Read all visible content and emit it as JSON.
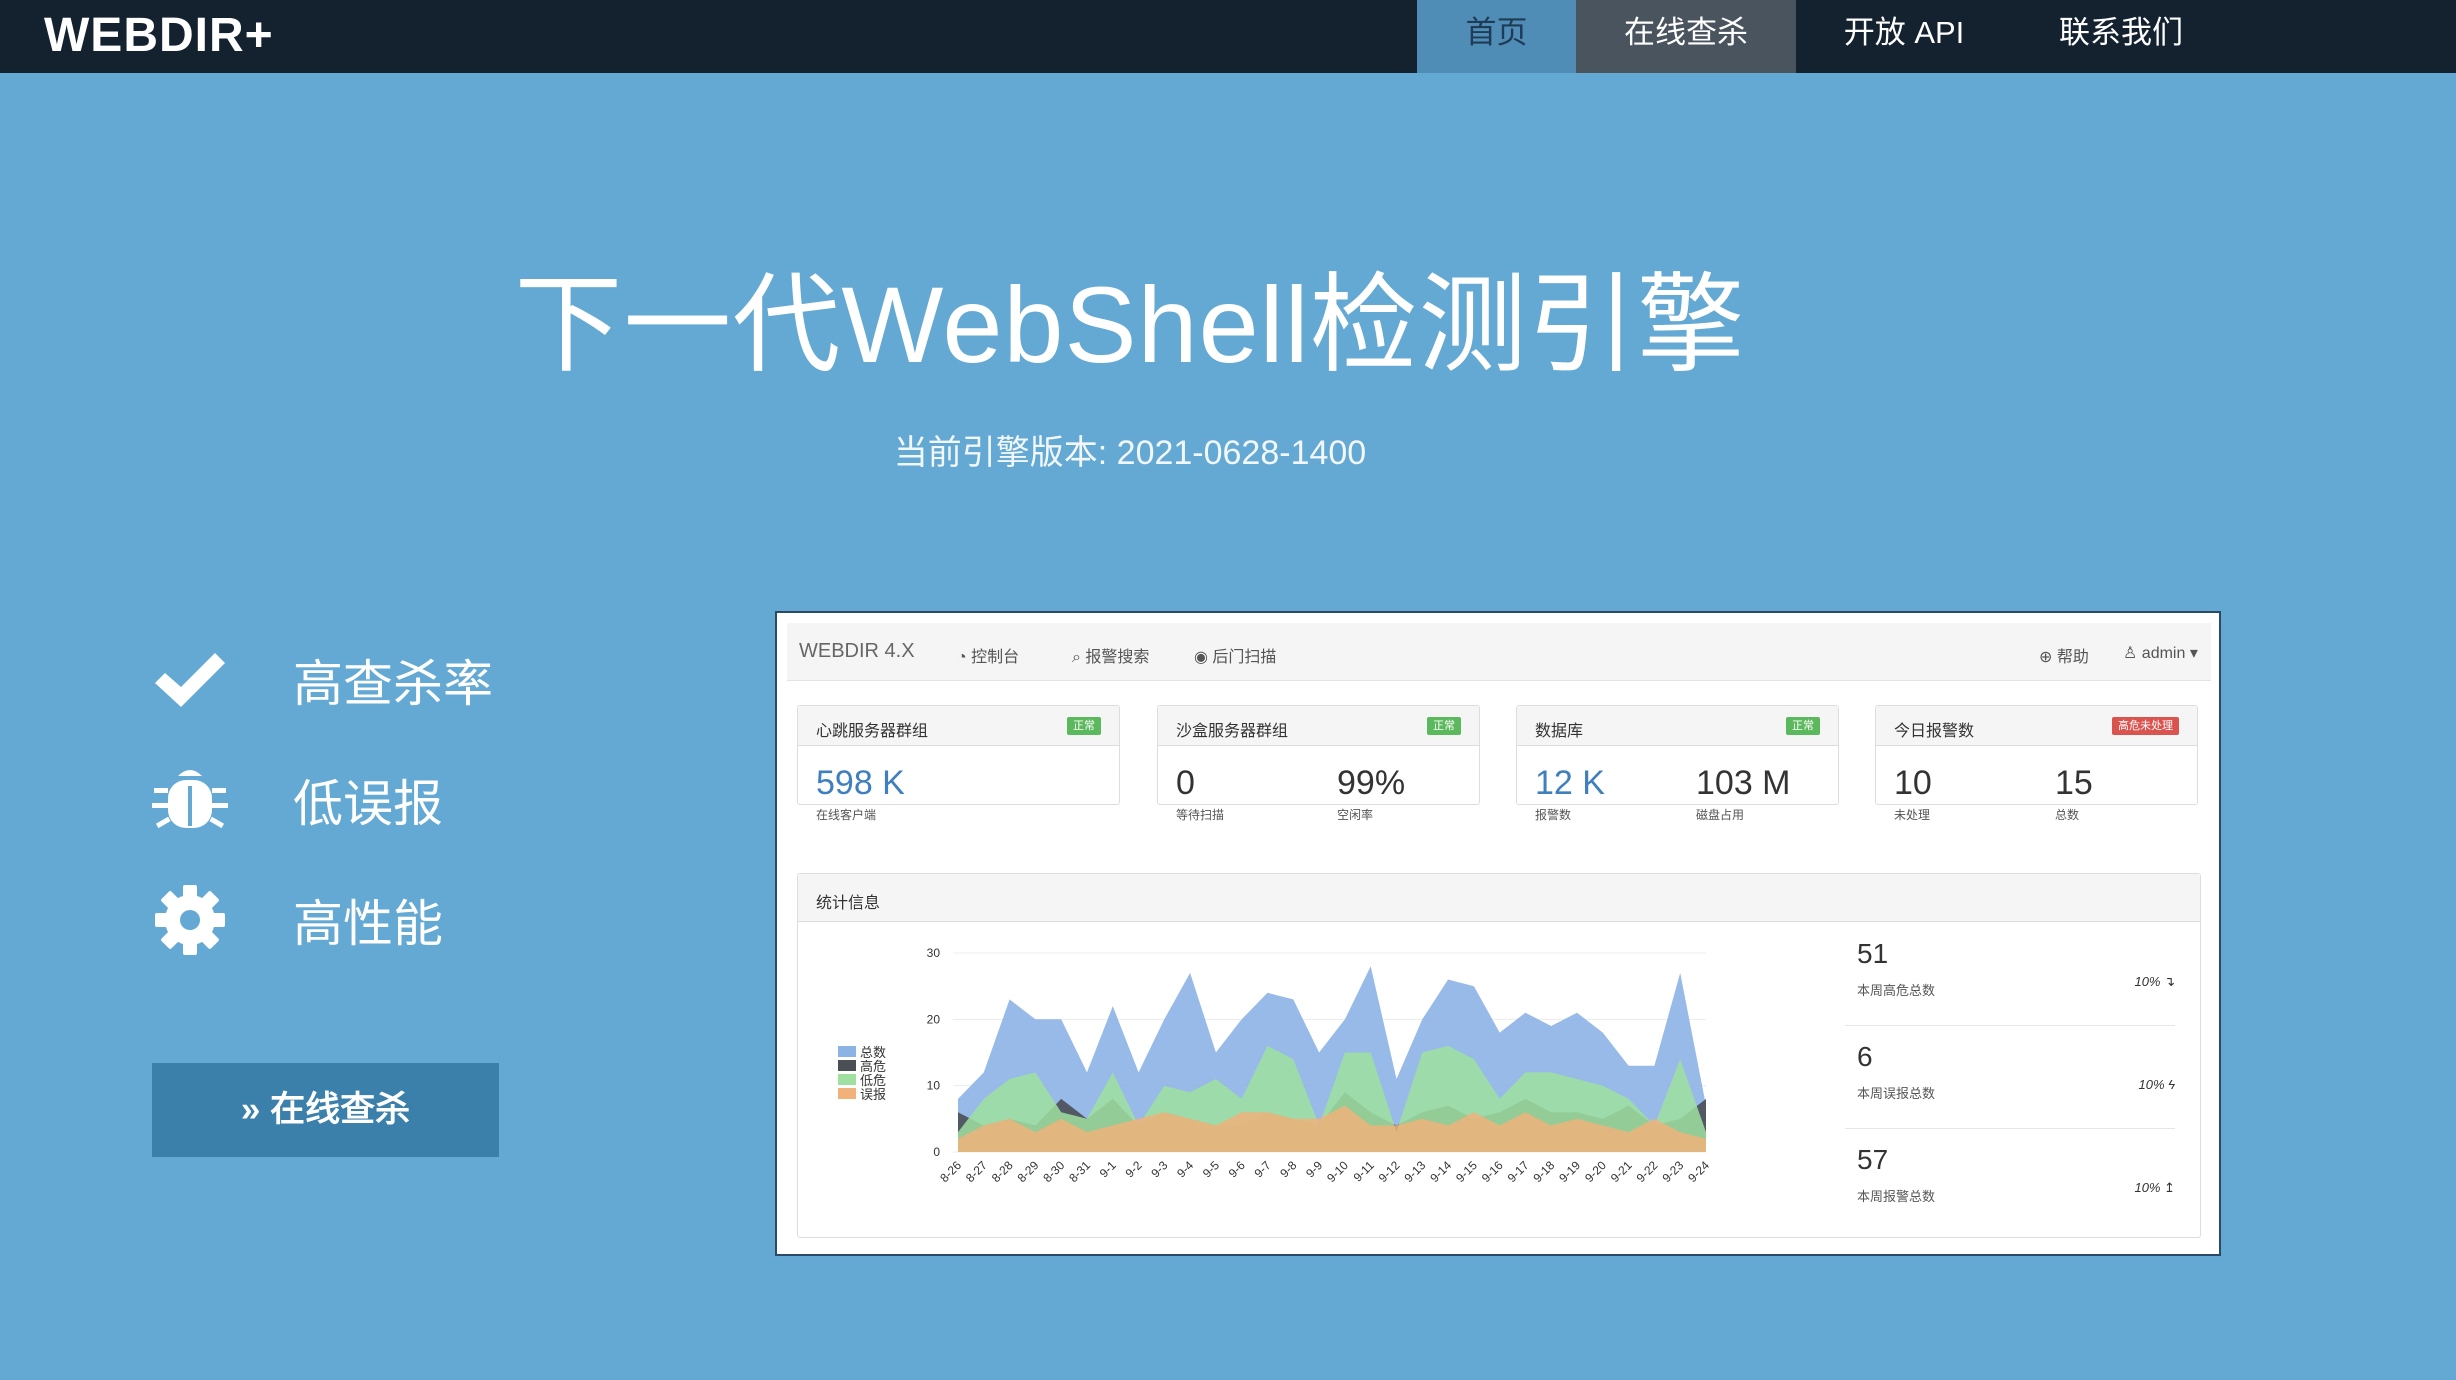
{
  "nav": {
    "brand": "WEBDIR+",
    "items": [
      "首页",
      "在线查杀",
      "开放 API",
      "联系我们"
    ]
  },
  "hero": {
    "title": "下一代WebShell检测引擎",
    "version": "当前引擎版本: 2021-0628-1400"
  },
  "features": [
    {
      "icon": "check-icon",
      "label": "高查杀率"
    },
    {
      "icon": "bug-icon",
      "label": "低误报"
    },
    {
      "icon": "gear-icon",
      "label": "高性能"
    }
  ],
  "cta_label": "» 在线查杀",
  "colors": {
    "background": "#63a9d3",
    "topbar": "#142230",
    "nav_active": "#4f8cb6",
    "nav_hover": "#4a545e",
    "button": "#3b80ab",
    "series_total": "#8cb3e6",
    "series_high": "#4a4f55",
    "series_low": "#9fe0a0",
    "series_false": "#f0b27a"
  },
  "screenshot": {
    "brand": "WEBDIR 4.X",
    "links": [
      "控制台",
      "报警搜索",
      "后门扫描"
    ],
    "right_links": [
      "帮助",
      "admin"
    ],
    "cards": [
      {
        "title": "心跳服务器群组",
        "badge": "正常",
        "status": "ok",
        "stats": [
          {
            "num": "598 K",
            "sub": "在线客户端"
          }
        ]
      },
      {
        "title": "沙盒服务器群组",
        "badge": "正常",
        "status": "ok",
        "stats": [
          {
            "num": "0",
            "sub": "等待扫描"
          },
          {
            "num": "99%",
            "sub": "空闲率"
          }
        ]
      },
      {
        "title": "数据库",
        "badge": "正常",
        "status": "ok",
        "stats": [
          {
            "num": "12 K",
            "sub": "报警数"
          },
          {
            "num": "103 M",
            "sub": "磁盘占用"
          }
        ]
      },
      {
        "title": "今日报警数",
        "badge": "高危未处理",
        "status": "bad",
        "stats": [
          {
            "num": "10",
            "sub": "未处理"
          },
          {
            "num": "15",
            "sub": "总数"
          }
        ]
      }
    ],
    "stats_title": "统计信息",
    "side_stats": [
      {
        "num": "51",
        "label": "本周高危总数",
        "pct": "10% ↴"
      },
      {
        "num": "6",
        "label": "本周误报总数",
        "pct": "10% ϟ"
      },
      {
        "num": "57",
        "label": "本周报警总数",
        "pct": "10% ↥"
      }
    ]
  },
  "chart_data": {
    "type": "area",
    "x": [
      "8-26",
      "8-27",
      "8-28",
      "8-29",
      "8-30",
      "8-31",
      "9-1",
      "9-2",
      "9-3",
      "9-4",
      "9-5",
      "9-6",
      "9-7",
      "9-8",
      "9-9",
      "9-10",
      "9-11",
      "9-12",
      "9-13",
      "9-14",
      "9-15",
      "9-16",
      "9-17",
      "9-18",
      "9-19",
      "9-20",
      "9-21",
      "9-22",
      "9-23",
      "9-24"
    ],
    "ylim": [
      0,
      30
    ],
    "yticks": [
      0,
      10,
      20,
      30
    ],
    "legend_placement": "left",
    "series": [
      {
        "name": "总数",
        "values": [
          8,
          12,
          23,
          20,
          20,
          12,
          22,
          12,
          20,
          27,
          15,
          20,
          24,
          23,
          15,
          20,
          28,
          11,
          20,
          26,
          25,
          18,
          21,
          19,
          21,
          18,
          13,
          13,
          27,
          7
        ]
      },
      {
        "name": "高危",
        "values": [
          6,
          4,
          5,
          4,
          8,
          5,
          8,
          4,
          6,
          5,
          4,
          4,
          6,
          5,
          4,
          9,
          6,
          4,
          6,
          7,
          5,
          6,
          8,
          6,
          6,
          5,
          7,
          4,
          5,
          8
        ]
      },
      {
        "name": "低危",
        "values": [
          3,
          8,
          11,
          12,
          6,
          5,
          12,
          4,
          10,
          9,
          11,
          8,
          16,
          14,
          4,
          15,
          15,
          3,
          15,
          16,
          14,
          8,
          12,
          12,
          11,
          10,
          8,
          4,
          14,
          3
        ]
      },
      {
        "name": "误报",
        "values": [
          2,
          4,
          5,
          3,
          5,
          3,
          4,
          5,
          6,
          5,
          4,
          6,
          6,
          5,
          5,
          7,
          4,
          4,
          5,
          4,
          6,
          4,
          6,
          4,
          5,
          4,
          3,
          5,
          3,
          2
        ]
      }
    ]
  }
}
